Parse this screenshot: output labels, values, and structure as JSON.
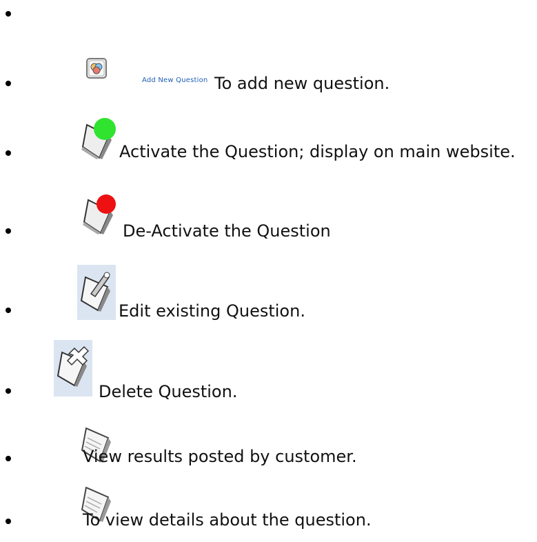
{
  "items": [
    {
      "label": ""
    },
    {
      "link_label": "Add New Question",
      "label": "To add new question.",
      "icon": "add-question-icon"
    },
    {
      "label": "Activate the Question; display on main website.",
      "icon": "activate-question-icon"
    },
    {
      "label": "De-Activate the Question",
      "icon": "deactivate-question-icon"
    },
    {
      "label": "Edit existing Question.",
      "icon": "edit-question-icon"
    },
    {
      "label": "Delete Question.",
      "icon": "delete-question-icon"
    },
    {
      "label": "View results posted by customer.",
      "icon": "view-results-icon"
    },
    {
      "label": "To view details about the question.",
      "icon": "view-details-icon"
    }
  ]
}
